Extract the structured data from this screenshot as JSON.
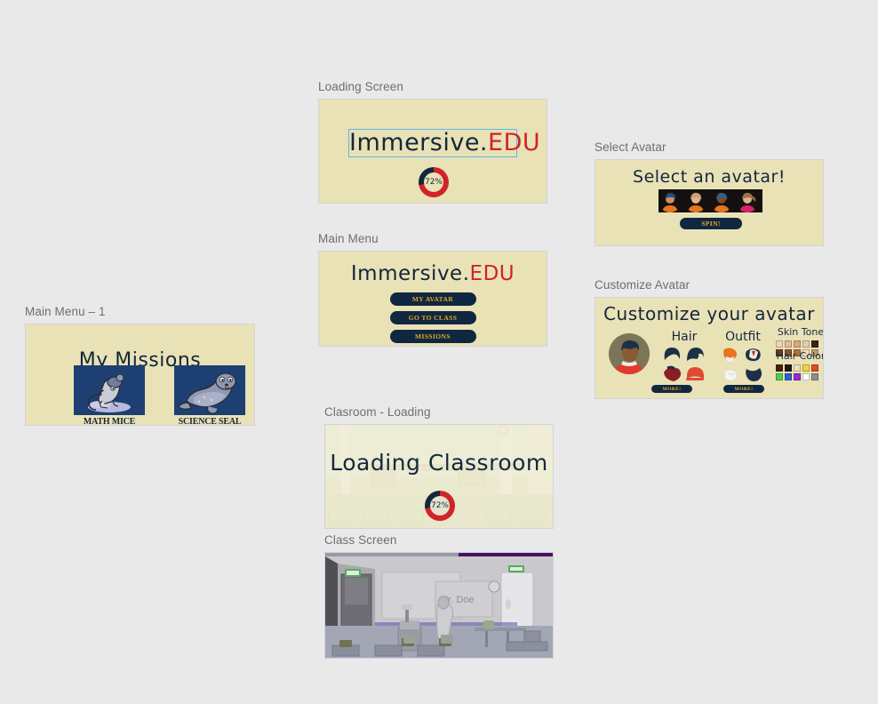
{
  "panels": {
    "missions": {
      "label": "Main Menu – 1",
      "heading": "My Missions",
      "cards": [
        {
          "name": "MATH MICE",
          "art": "mouse-on-ice"
        },
        {
          "name": "SCIENCE SEAL",
          "art": "seal"
        }
      ]
    },
    "loading": {
      "label": "Loading Screen",
      "title_primary": "Immersive.",
      "title_accent": "EDU",
      "progress_percent": "72%",
      "progress_value": 72
    },
    "main_menu": {
      "label": "Main Menu",
      "title_primary": "Immersive.",
      "title_accent": "EDU",
      "buttons": [
        "MY AVATAR",
        "GO TO CLASS",
        "MISSIONS"
      ]
    },
    "classroom_loading": {
      "label": "Clasroom - Loading",
      "title": "Loading Classroom",
      "progress_percent": "72%",
      "progress_value": 72
    },
    "class_screen": {
      "label": "Class Screen",
      "whiteboard_text": "Mr. Doe"
    },
    "select_avatar": {
      "label": "Select Avatar",
      "title": "Select an avatar!",
      "spin_button": "SPIN!",
      "avatars": [
        {
          "hair": "#2b4a7a",
          "skin": "#c98e63",
          "shirt": "#e8741f"
        },
        {
          "hair": "#c8a178",
          "skin": "#e3b48c",
          "shirt": "#e8741f"
        },
        {
          "hair": "#2e5f8a",
          "skin": "#7a4a2c",
          "shirt": "#e8741f"
        },
        {
          "hair": "#9e7248",
          "skin": "#e0b48d",
          "shirt": "#d6246c"
        }
      ]
    },
    "customize_avatar": {
      "label": "Customize Avatar",
      "title": "Customize your avatar",
      "sections": [
        {
          "name": "Hair",
          "more_button": "MORE!",
          "options": [
            "#1d3048",
            "#1d3048",
            "#8c1d22",
            "#e04a32"
          ]
        },
        {
          "name": "Outfit",
          "more_button": "MORE!",
          "options": [
            "#e8741f",
            "#8c1d22",
            "#f2f2ee",
            "#1d3048"
          ]
        }
      ],
      "palettes": [
        {
          "name": "Skin Tone",
          "colors": [
            "#f3d3b8",
            "#e6bb96",
            "#d8a97f",
            "#e8cbb0",
            "#3c2216",
            "#6b3d22",
            "#8a5430",
            "#a9743f",
            "#f0dcc6",
            "#c79a6e"
          ]
        },
        {
          "name": "Hair Color",
          "colors": [
            "#4a1f0e",
            "#241611",
            "#ede0c0",
            "#f2d437",
            "#e04a23",
            "#4cd14c",
            "#2a62d6",
            "#9a2ad6",
            "#ffffff",
            "#8d8d8d"
          ]
        }
      ],
      "preview": {
        "hair": "#1d3048",
        "skin": "#8a5a37",
        "shirt": "#e23a2e"
      }
    }
  },
  "theme": {
    "page_background": "#e9e9e9",
    "panel_background": "#e9e2b6",
    "panel_border": "#d2d2da",
    "label_color": "#6e6e6e",
    "navy": "#14263c",
    "accent_red": "#d1232a",
    "button_navy": "#0f2740",
    "button_gold": "#e8a920",
    "selection_blue": "#63b6e8"
  }
}
